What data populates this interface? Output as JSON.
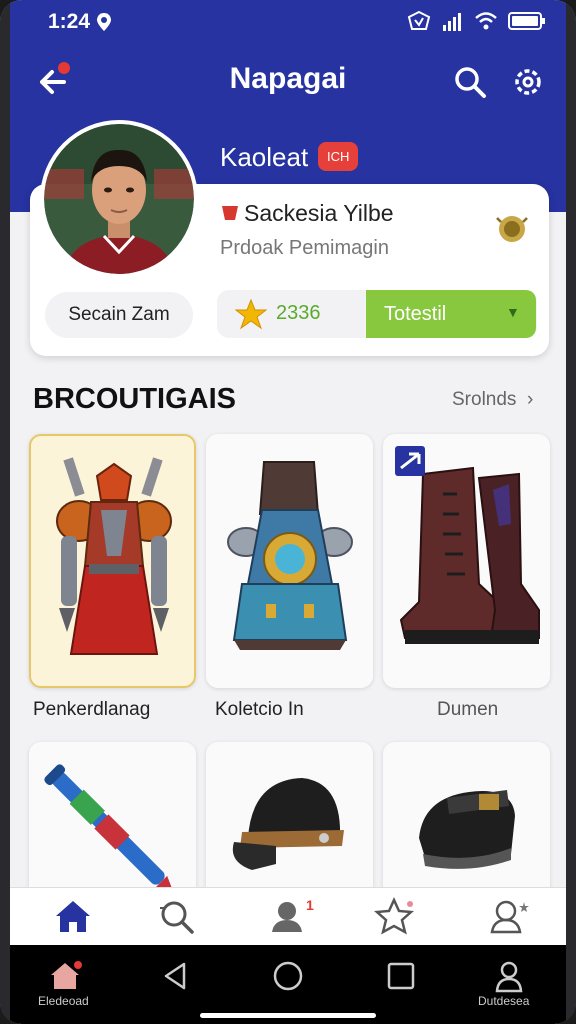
{
  "status_bar": {
    "time": "1:24"
  },
  "app_bar": {
    "title": "Napagai"
  },
  "profile": {
    "name": "Kaoleat",
    "name_badge": "ICH",
    "card_title": "Sackesia Yilbe",
    "card_subtitle": "Prdoak Pemimagin",
    "pill_button": "Secain Zam",
    "score": "2336",
    "action_button": "Totestil"
  },
  "section": {
    "title": "BRCOUTIGAIS",
    "link": "Srolnds"
  },
  "items": [
    {
      "label": "Penkerdlanag",
      "icon": "armor-icon"
    },
    {
      "label": "Koletcio In",
      "icon": "robot-armor-icon"
    },
    {
      "label": "Dumen",
      "icon": "boots-icon"
    },
    {
      "label": "",
      "icon": "dagger-icon"
    },
    {
      "label": "",
      "icon": "cap-icon"
    },
    {
      "label": "",
      "icon": "shoe-icon"
    }
  ],
  "tabs": [
    {
      "name": "home-icon"
    },
    {
      "name": "search-icon"
    },
    {
      "name": "friends-icon",
      "count": "1"
    },
    {
      "name": "star-icon"
    },
    {
      "name": "profile-icon"
    }
  ],
  "nav": {
    "left_label": "Eledeoad",
    "right_label": "Dutdesea"
  },
  "colors": {
    "header": "#2633a0",
    "accent_green": "#88c83f",
    "badge_red": "#e6403a"
  }
}
